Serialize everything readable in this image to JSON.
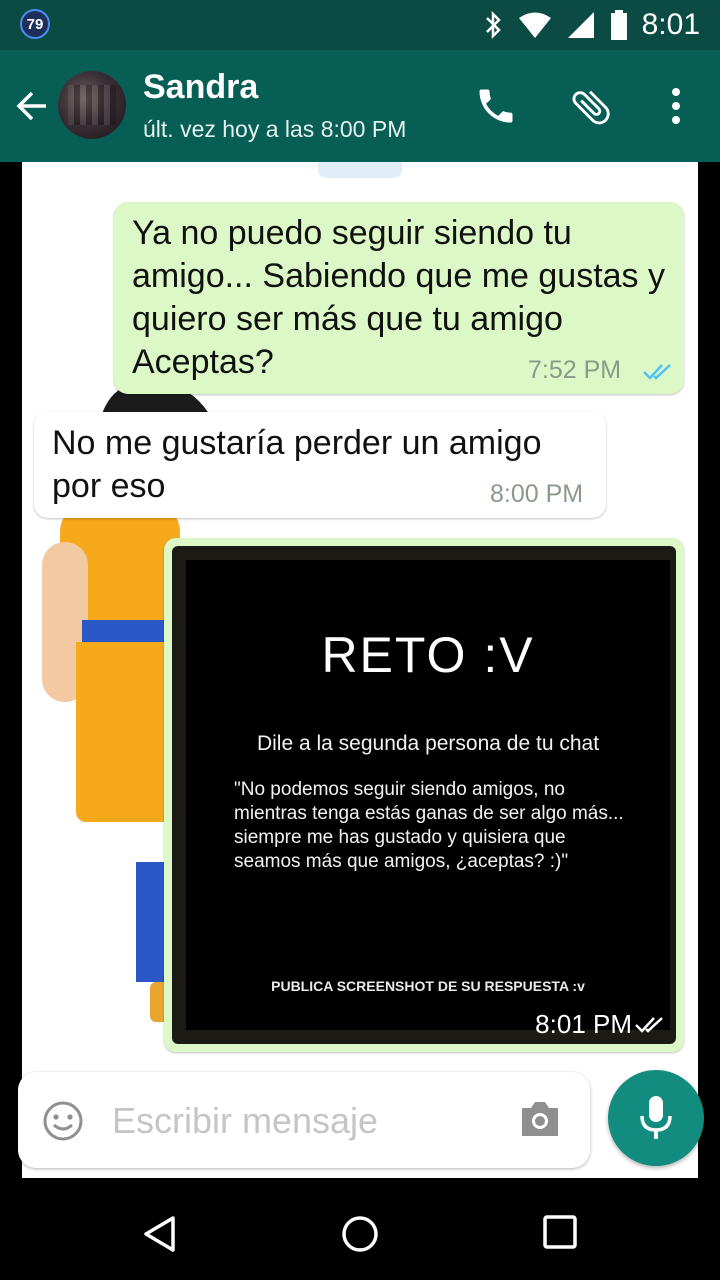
{
  "status_bar": {
    "badge": "79",
    "time": "8:01"
  },
  "header": {
    "contact_name": "Sandra",
    "last_seen": "últ. vez hoy a las 8:00 PM",
    "icons": [
      "back-arrow-icon",
      "phone-icon",
      "attach-icon",
      "more-vert-icon"
    ]
  },
  "messages": [
    {
      "direction": "outgoing",
      "text": "Ya no puedo seguir siendo tu amigo... Sabiendo que me gustas y quiero ser más que tu amigo Aceptas?",
      "time": "7:52 PM",
      "status": "read"
    },
    {
      "direction": "incoming",
      "text": "No me gustaría perder un amigo por eso",
      "time": "8:00 PM"
    },
    {
      "direction": "outgoing",
      "type": "image",
      "image": {
        "title": "RETO :V",
        "subtitle": "Dile a la segunda persona de tu chat",
        "quote": "\"No podemos seguir siendo amigos, no mientras tenga estás ganas de ser algo más... siempre me has gustado y quisiera que seamos más que amigos, ¿aceptas? :)\"",
        "footer": "PUBLICA SCREENSHOT DE SU RESPUESTA :v"
      },
      "time": "8:01 PM",
      "status": "delivered"
    }
  ],
  "composer": {
    "placeholder": "Escribir mensaje"
  },
  "colors": {
    "status_bar": "#0b4b43",
    "app_bar": "#075e54",
    "outgoing_bubble": "#dcf8c6",
    "mic_button": "#128c7e",
    "read_ticks": "#4fc3f7"
  }
}
